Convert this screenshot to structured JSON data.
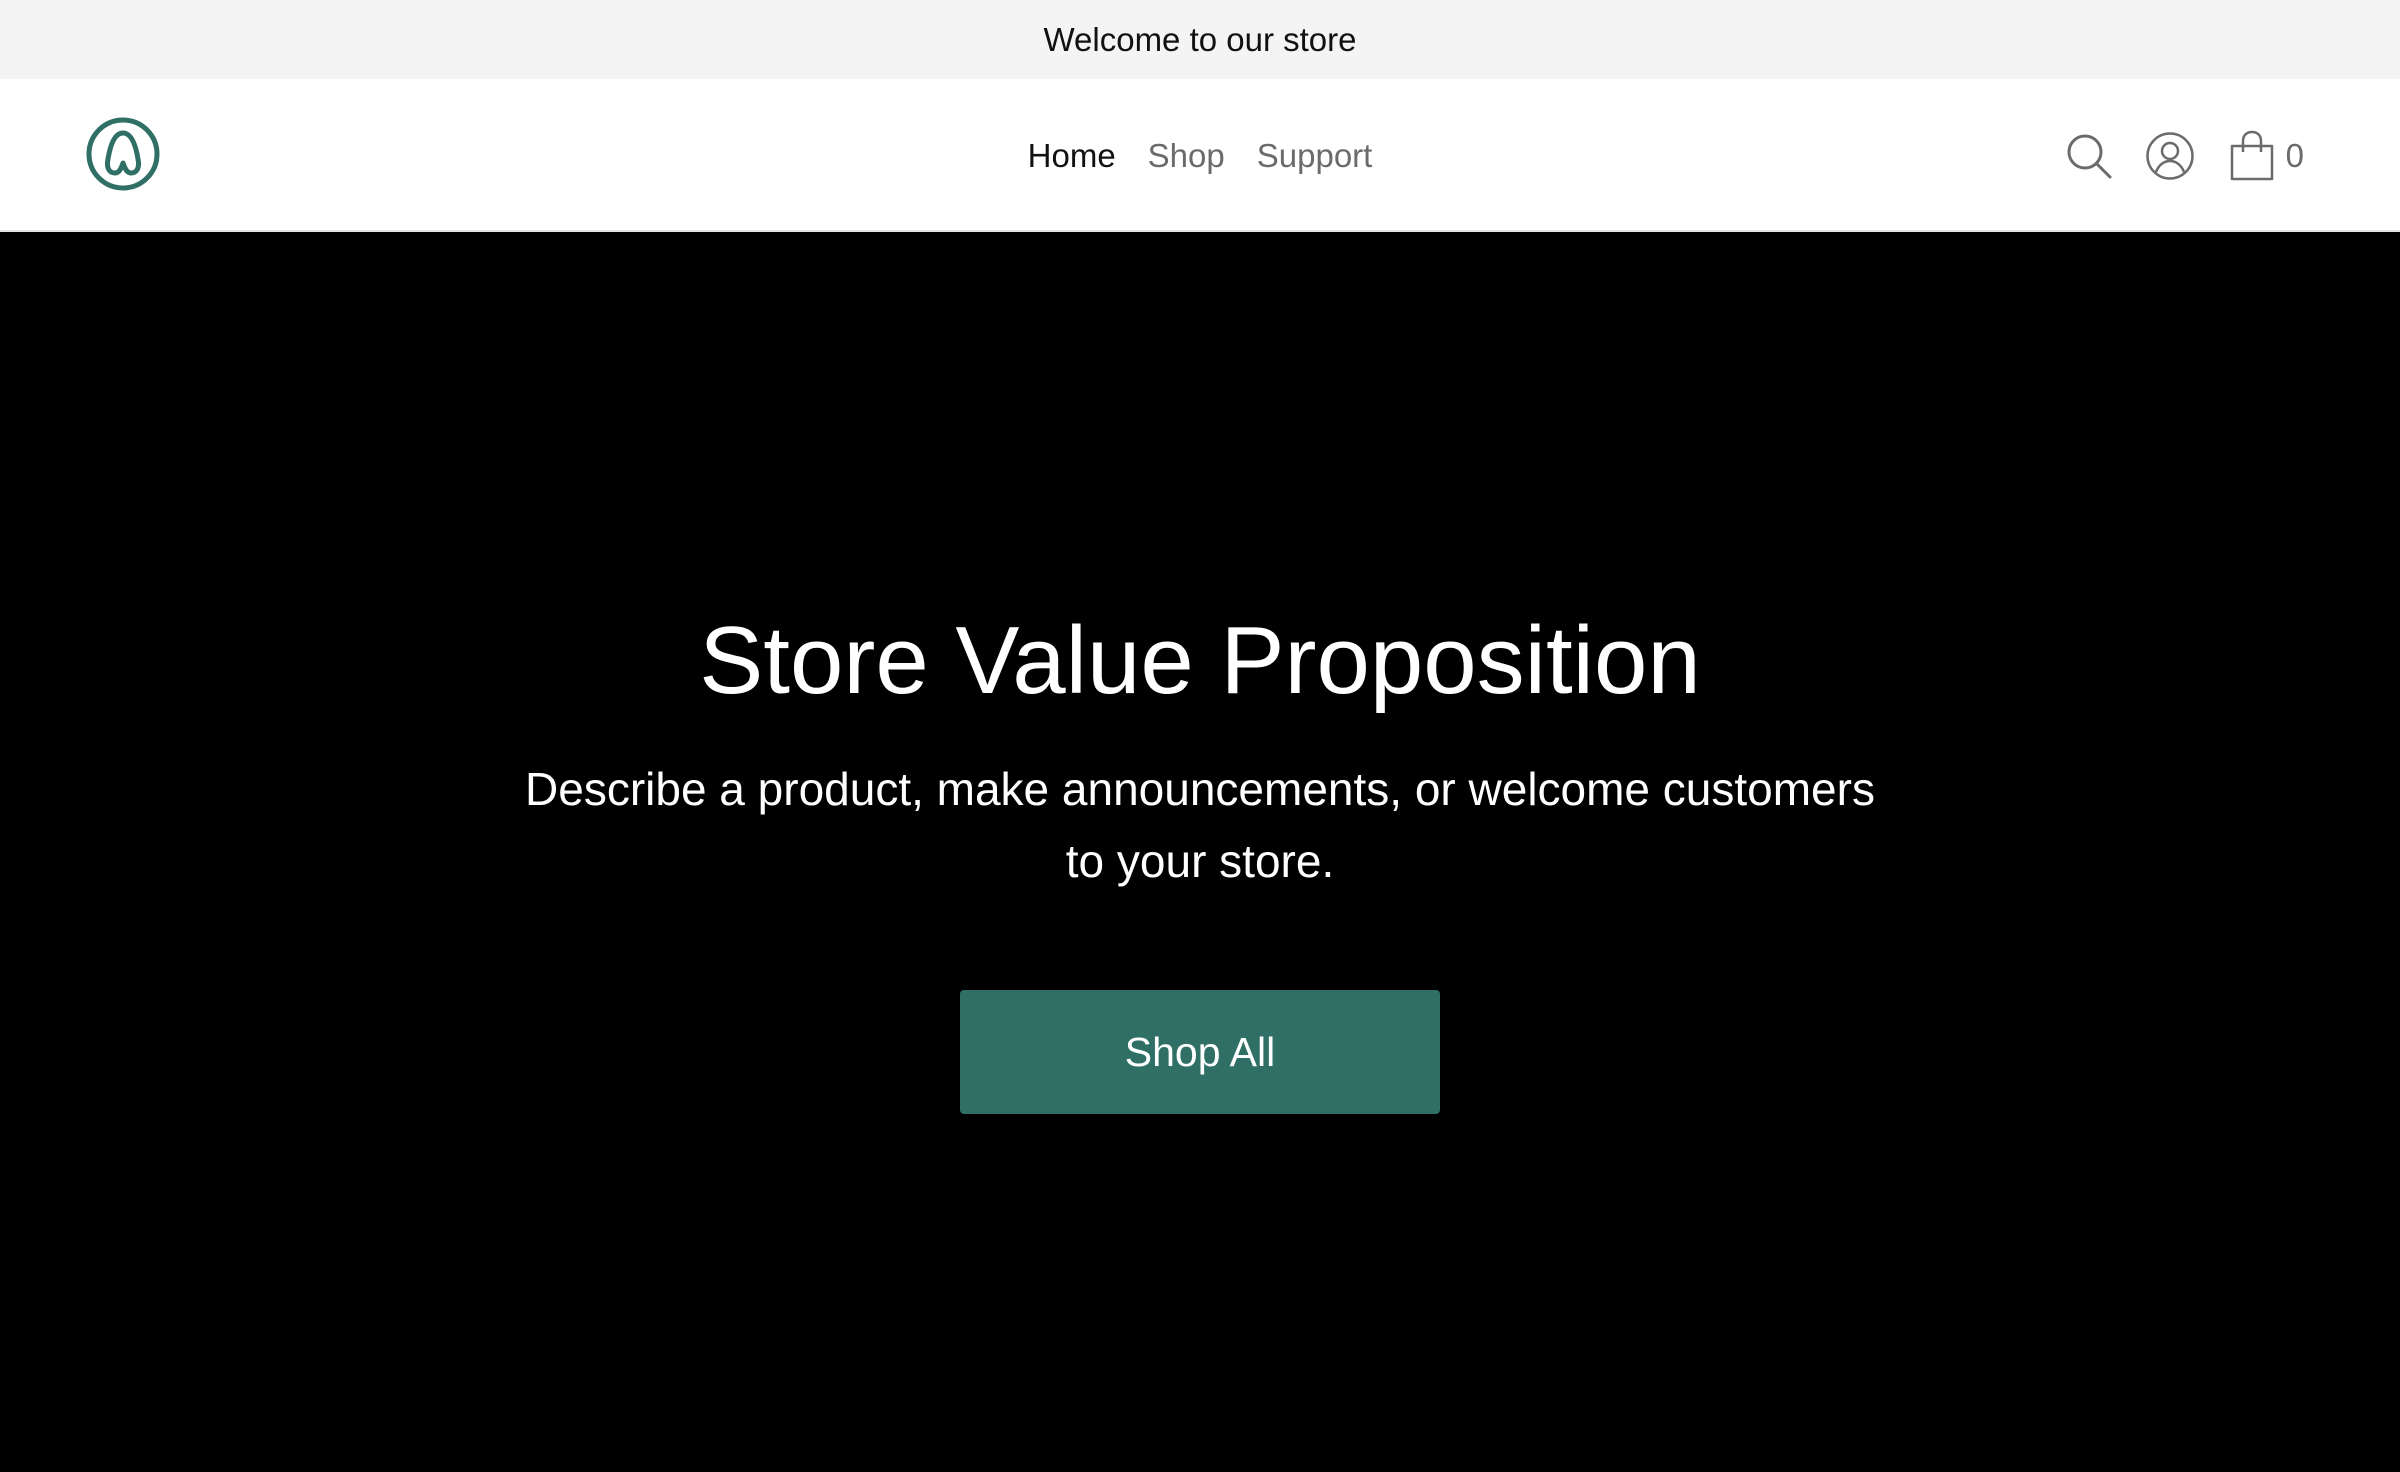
{
  "announcement": {
    "text": "Welcome to our store"
  },
  "header": {
    "logo_icon": "brand-a-logo-icon",
    "nav": [
      {
        "label": "Home",
        "active": true
      },
      {
        "label": "Shop",
        "active": false
      },
      {
        "label": "Support",
        "active": false
      }
    ],
    "icons": {
      "search": "search-icon",
      "account": "account-icon",
      "cart": "shopping-bag-icon"
    },
    "cart_count": "0"
  },
  "hero": {
    "title": "Store Value Proposition",
    "description": "Describe a product, make announcements, or welcome customers to your store.",
    "cta_label": "Shop All"
  },
  "colors": {
    "brand_accent": "#2f6f66",
    "announcement_bg": "#f4f4f4",
    "hero_bg": "#000000",
    "nav_active": "#111111",
    "nav_inactive": "#6b6b6b"
  }
}
